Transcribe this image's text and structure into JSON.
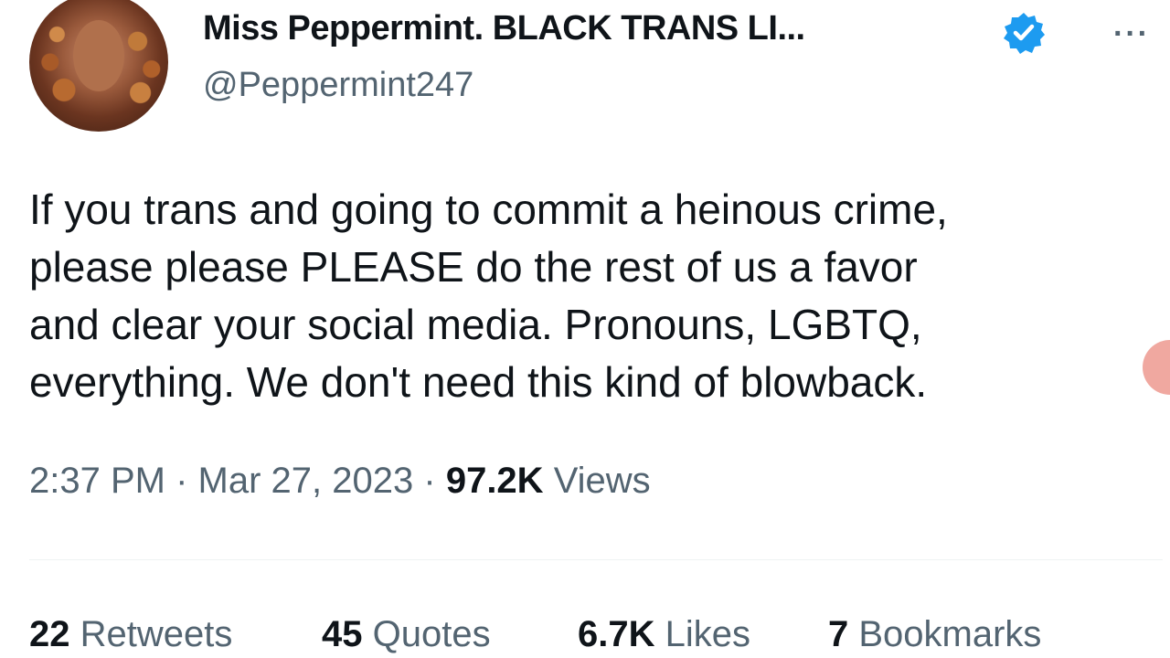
{
  "author": {
    "display_name": "Miss Peppermint. BLACK TRANS LI...",
    "handle": "@Peppermint247"
  },
  "icons": {
    "verified": "verified-badge-icon",
    "more": "more-options-icon",
    "verified_color": "#1d9bf0"
  },
  "tweet": {
    "lines": [
      "If you trans and going to commit a heinous crime,",
      "please please PLEASE do the rest of us a favor",
      "and clear your social media. Pronouns, LGBTQ,",
      "everything. We don't need this kind of blowback."
    ]
  },
  "meta": {
    "time": "2:37 PM",
    "separator": "·",
    "date": "Mar 27, 2023",
    "views_count": "97.2K",
    "views_label": "Views"
  },
  "stats": {
    "retweets_count": "22",
    "retweets_label": "Retweets",
    "quotes_count": "45",
    "quotes_label": "Quotes",
    "likes_count": "6.7K",
    "likes_label": "Likes",
    "bookmarks_count": "7",
    "bookmarks_label": "Bookmarks"
  },
  "colors": {
    "text": "#0f1419",
    "secondary": "#536471",
    "accent": "#1d9bf0"
  }
}
